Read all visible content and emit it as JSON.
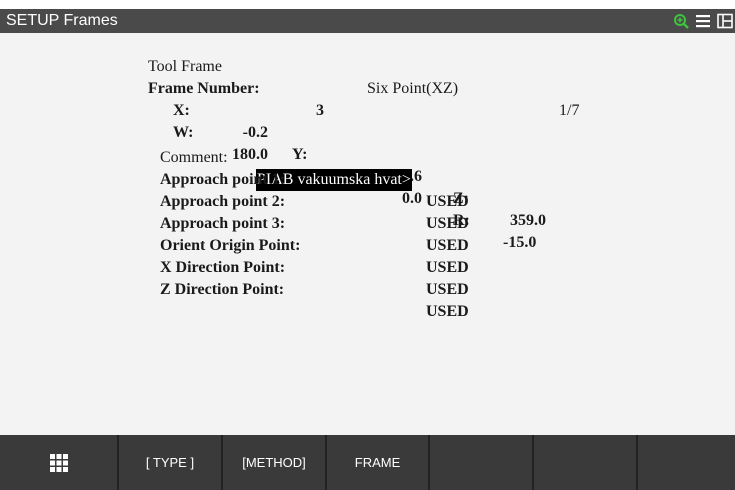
{
  "window": {
    "title": "SETUP Frames"
  },
  "frame": {
    "tool_frame_label": "Tool Frame",
    "method_label": "Six Point(XZ)",
    "page": "1/7",
    "frame_number_label": "Frame Number:",
    "frame_number": "3",
    "x_label": "X:",
    "x": "-0.2",
    "y_label": "Y:",
    "y": "0.6",
    "z_label": "Z:",
    "z": "359.0",
    "w_label": "W:",
    "w": "180.0",
    "p_label": "P:",
    "p": "0.0",
    "r_label": "R:",
    "r": "-15.0",
    "comment_label": "Comment:",
    "comment": "PIAB vakuumska hvat>"
  },
  "points": [
    {
      "label": "Approach point 1:",
      "status": "USED"
    },
    {
      "label": "Approach point 2:",
      "status": "USED"
    },
    {
      "label": "Approach point 3:",
      "status": "USED"
    },
    {
      "label": "Orient Origin Point:",
      "status": "USED"
    },
    {
      "label": "X Direction Point:",
      "status": "USED"
    },
    {
      "label": "Z Direction Point:",
      "status": "USED"
    }
  ],
  "footer": {
    "menu_icon": "grid-icon",
    "keys": [
      "[ TYPE ]",
      "[METHOD]",
      "FRAME",
      "",
      "",
      ""
    ]
  },
  "icons": [
    "zoom-in-icon",
    "menu-icon",
    "split-window-icon"
  ],
  "colors": {
    "titlebar": "#4a4a4a",
    "background": "#f3f3f3",
    "footer": "#333333",
    "zoom_icon": "#3ec43e"
  }
}
